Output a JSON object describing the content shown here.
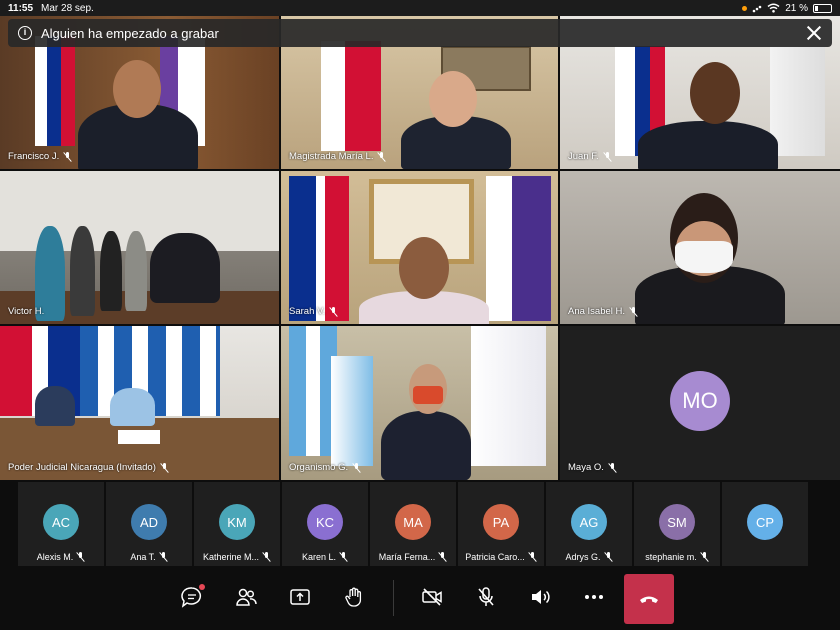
{
  "status": {
    "time": "11:55",
    "date": "Mar 28 sep.",
    "battery": "21 %"
  },
  "banner": {
    "text": "Alguien ha empezado a grabar"
  },
  "tiles": [
    {
      "name": "Francisco J."
    },
    {
      "name": "Magistrada María L."
    },
    {
      "name": "Juan F."
    },
    {
      "name": "Victor H."
    },
    {
      "name": "Sarah V."
    },
    {
      "name": "Ana Isabel H."
    },
    {
      "name": "Poder Judicial Nicaragua (Invitado)"
    },
    {
      "name": "Organismo G."
    },
    {
      "name": "Maya O.",
      "initials": "MO"
    }
  ],
  "participants": [
    {
      "initials": "AC",
      "name": "Alexis M.",
      "color": "#4aa6b8"
    },
    {
      "initials": "AD",
      "name": "Ana T.",
      "color": "#3f7cae"
    },
    {
      "initials": "KM",
      "name": "Katherine M...",
      "color": "#4aa6b8"
    },
    {
      "initials": "KC",
      "name": "Karen L.",
      "color": "#8a6fd1"
    },
    {
      "initials": "MA",
      "name": "María Ferna...",
      "color": "#d26749"
    },
    {
      "initials": "PA",
      "name": "Patricia Caro...",
      "color": "#d26749"
    },
    {
      "initials": "AG",
      "name": "Adrys G.",
      "color": "#5aaed6"
    },
    {
      "initials": "SM",
      "name": "stephanie m.",
      "color": "#8a6fa8"
    },
    {
      "initials": "CP",
      "name": "",
      "color": "#64b0e8"
    }
  ],
  "colors": {
    "hangup": "#c4314b",
    "notification": "#e74856"
  }
}
